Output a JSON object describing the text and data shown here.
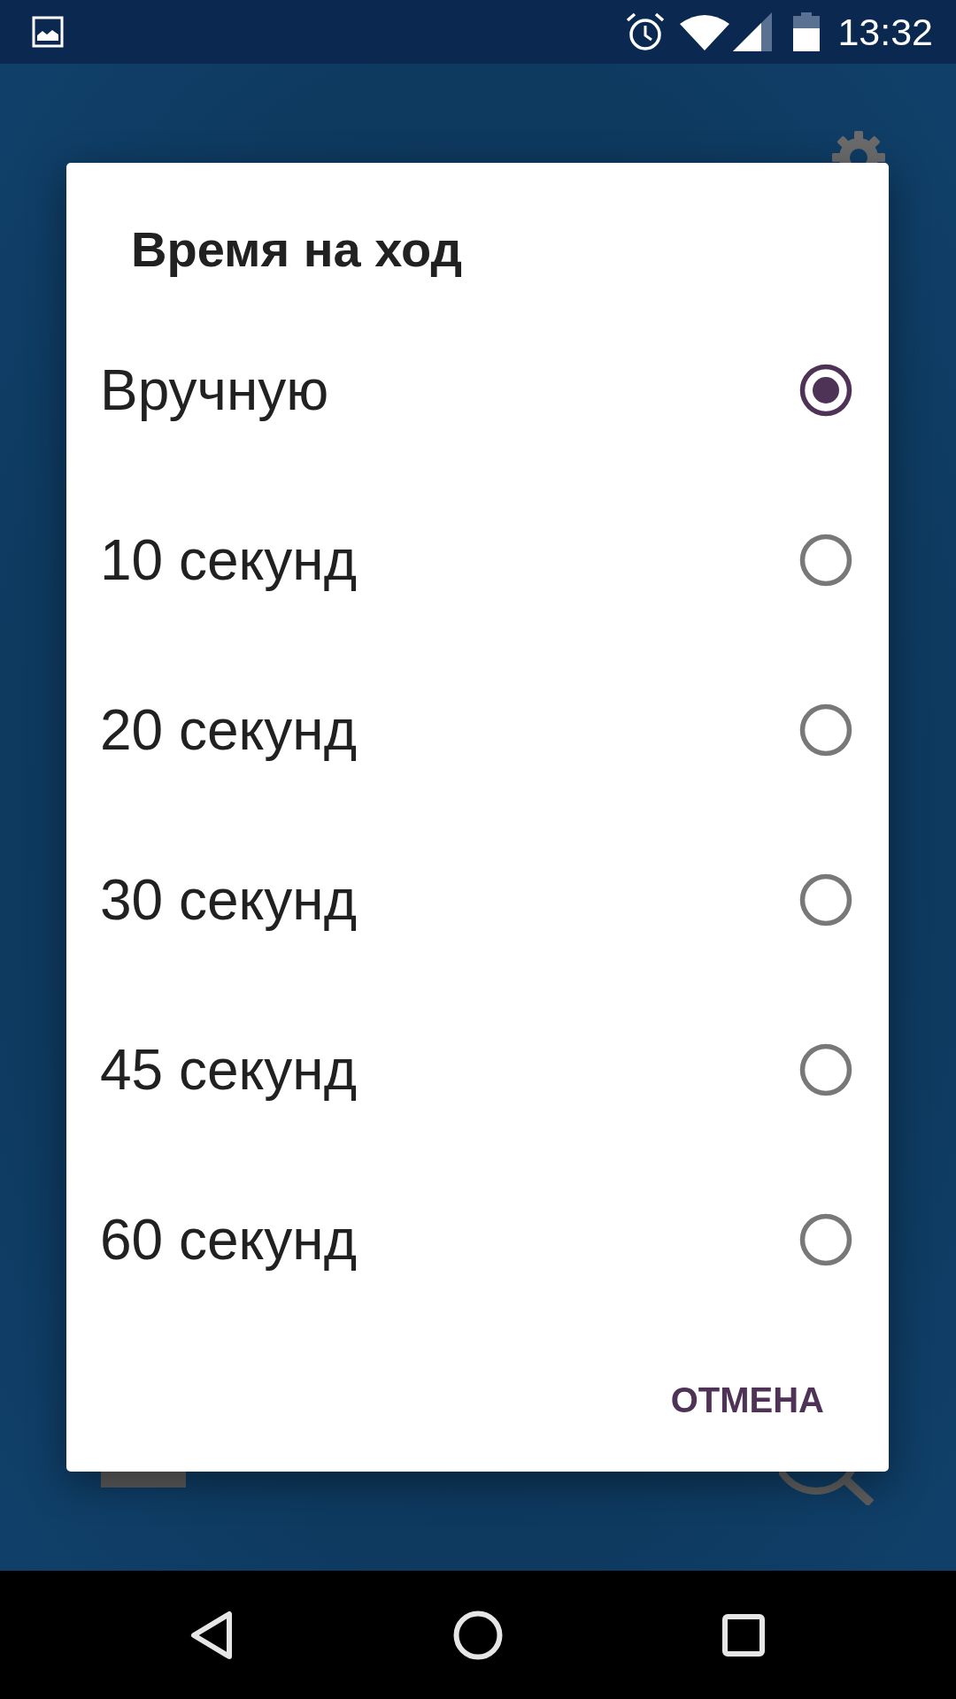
{
  "status_bar": {
    "time": "13:32"
  },
  "dialog": {
    "title": "Время на ход",
    "options": [
      {
        "label": "Вручную",
        "selected": true
      },
      {
        "label": "10 секунд",
        "selected": false
      },
      {
        "label": "20 секунд",
        "selected": false
      },
      {
        "label": "30 секунд",
        "selected": false
      },
      {
        "label": "45 секунд",
        "selected": false
      },
      {
        "label": "60 секунд",
        "selected": false
      }
    ],
    "buttons": [
      "ОТМЕНА"
    ]
  }
}
